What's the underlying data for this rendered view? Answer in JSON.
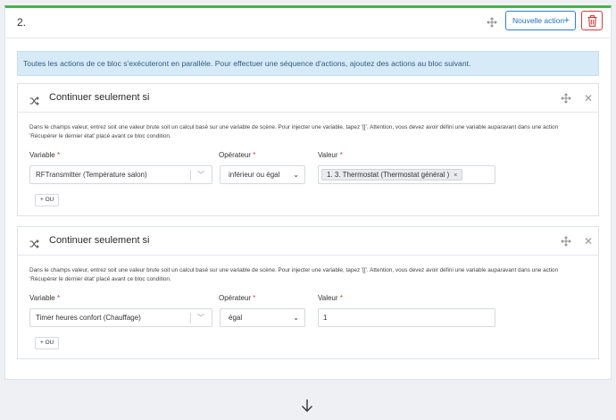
{
  "block": {
    "number": "2.",
    "new_action_label": "Nouvelle action",
    "new_action_icon": "+",
    "info_text": "Toutes les actions de ce bloc s'exécuteront en parallèle. Pour effectuer une séquence d'actions, ajoutez des actions au bloc suivant."
  },
  "conditions": [
    {
      "title": "Continuer seulement si",
      "help_line1": "Dans le champs valeur, entrez soit une valeur brute soit un calcul basé sur une variable de scène. Pour injecter une variable, tapez '[['. Attention, vous devez avoir défini une variable auparavant dans une action",
      "help_line2": "'Récupérer le dernier état' placé avant ce bloc condition.",
      "variable_label": "Variable",
      "variable_value": "RFTransmitter (Température salon)",
      "operator_label": "Opérateur",
      "operator_value": "inférieur ou égal",
      "value_label": "Valeur",
      "value_tag": "1. 3. Thermostat (Thermostat général )",
      "tag_remove": "×",
      "or_button": "+ OU",
      "required_mark": "*"
    },
    {
      "title": "Continuer seulement si",
      "help_line1": "Dans le champs valeur, entrez soit une valeur brute soit un calcul basé sur une variable de scène. Pour injecter une variable, tapez '[['. Attention, vous devez avoir défini une variable auparavant dans une action",
      "help_line2": "'Récupérer le dernier état' placé avant ce bloc condition.",
      "variable_label": "Variable",
      "variable_value": "Timer heures confort (Chauffage)",
      "operator_label": "Opérateur",
      "operator_value": "égal",
      "value_label": "Valeur",
      "value_input": "1",
      "or_button": "+ OU",
      "required_mark": "*"
    }
  ],
  "colors": {
    "accent_green": "#4caf50",
    "primary_blue": "#1f6fc0",
    "danger_red": "#d33b3b",
    "info_bg": "#d7eaf7"
  }
}
